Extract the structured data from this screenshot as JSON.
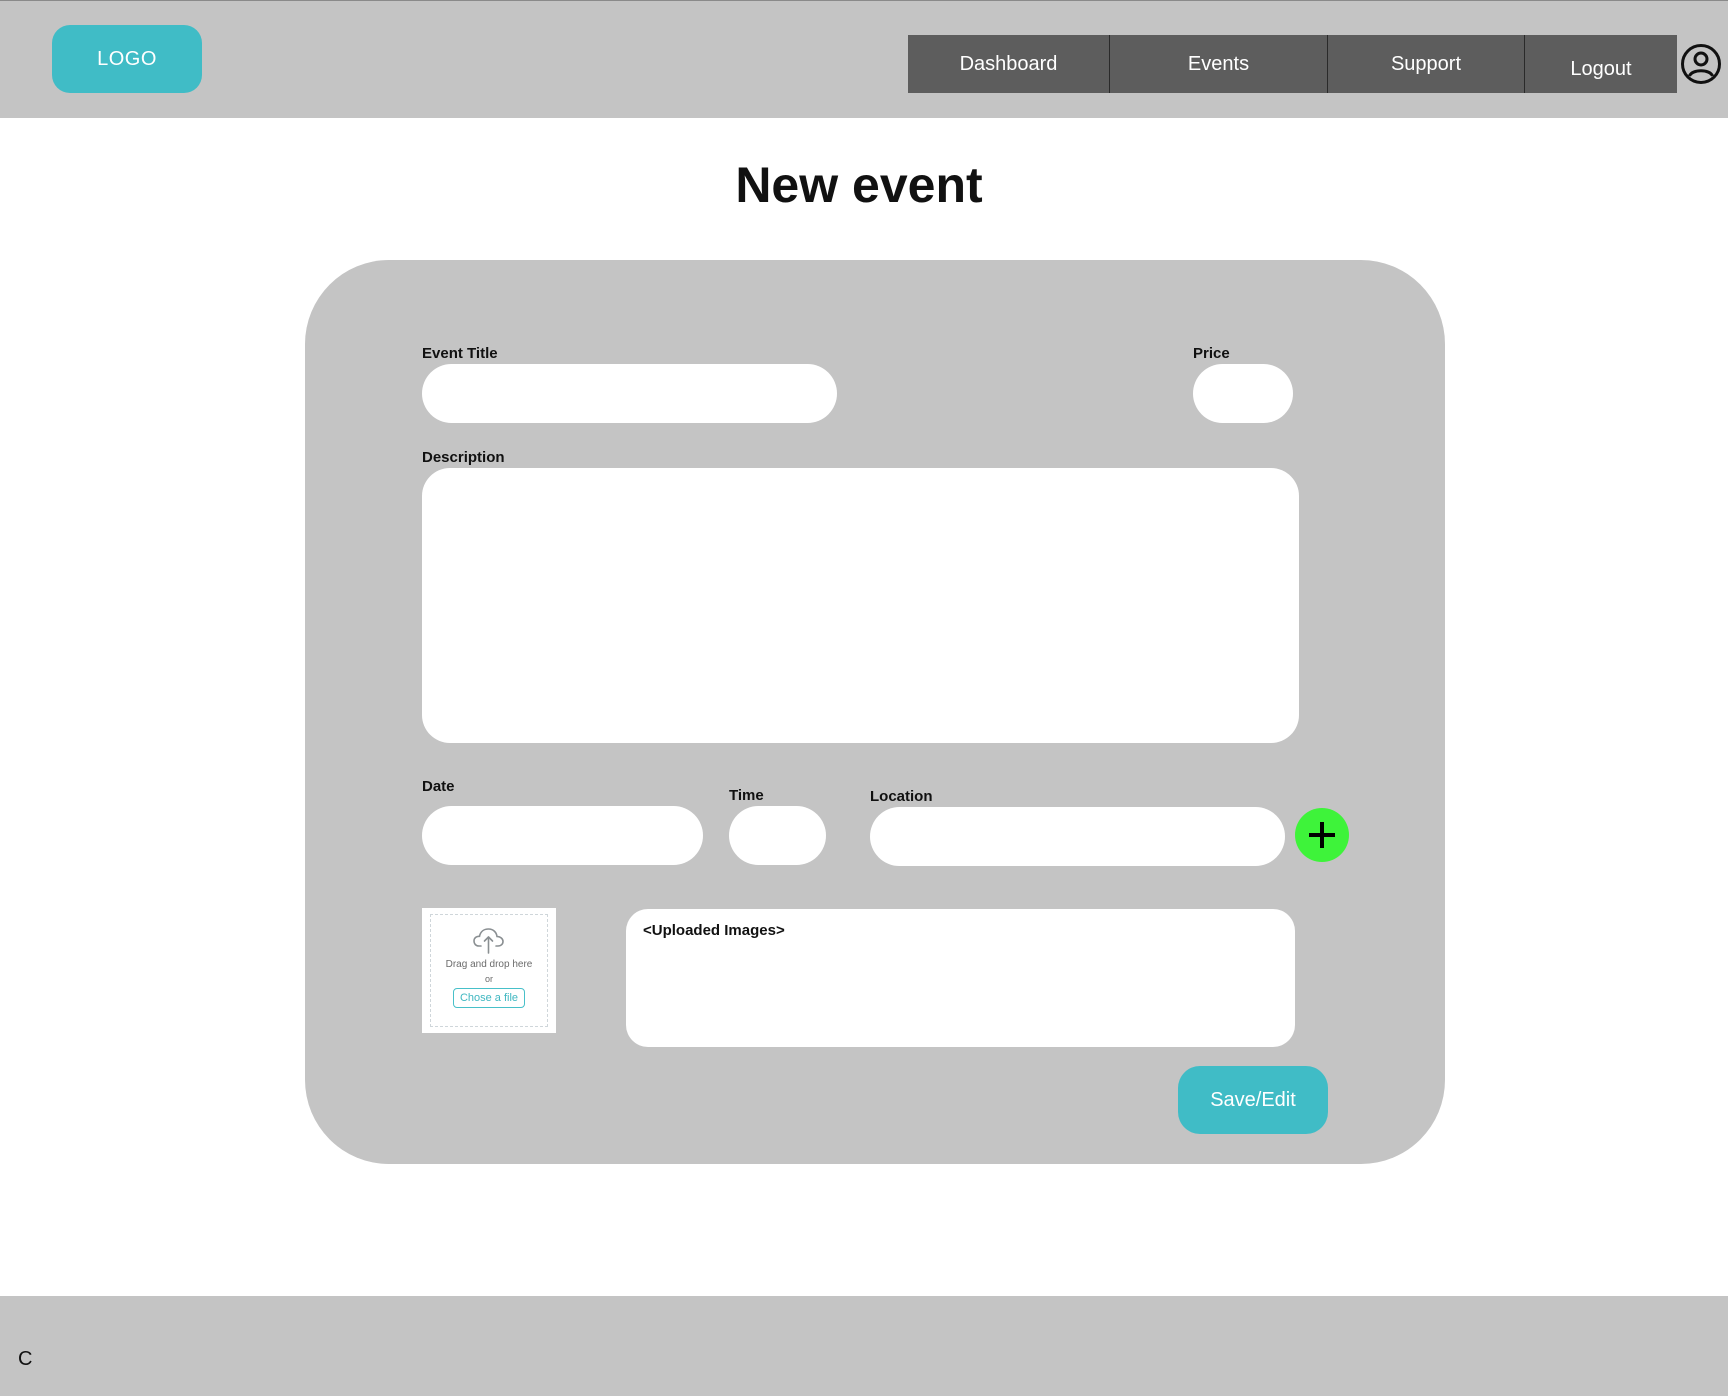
{
  "header": {
    "logo_label": "LOGO",
    "nav": [
      {
        "label": "Dashboard"
      },
      {
        "label": "Events"
      },
      {
        "label": "Support"
      },
      {
        "label": "Logout"
      }
    ],
    "avatar_icon": "user-circle-icon"
  },
  "page": {
    "title": "New event"
  },
  "form": {
    "event_title": {
      "label": "Event Title",
      "value": "",
      "placeholder": ""
    },
    "price": {
      "label": "Price",
      "value": "",
      "placeholder": ""
    },
    "description": {
      "label": "Description",
      "value": "",
      "placeholder": ""
    },
    "date": {
      "label": "Date",
      "value": "",
      "placeholder": ""
    },
    "time": {
      "label": "Time",
      "value": "",
      "placeholder": ""
    },
    "location": {
      "label": "Location",
      "value": "",
      "placeholder": ""
    },
    "add_location_icon": "plus-icon",
    "upload": {
      "icon": "cloud-upload-icon",
      "hint": "Drag and drop here",
      "or": "or",
      "choose_label": "Chose a file"
    },
    "uploaded_images": "<Uploaded Images>",
    "save_label": "Save/Edit"
  },
  "footer": {
    "text": "C"
  },
  "colors": {
    "accent": "#40bcc6",
    "panel": "#c4c4c4",
    "nav": "#5d5d5d",
    "add": "#3ef33a"
  }
}
